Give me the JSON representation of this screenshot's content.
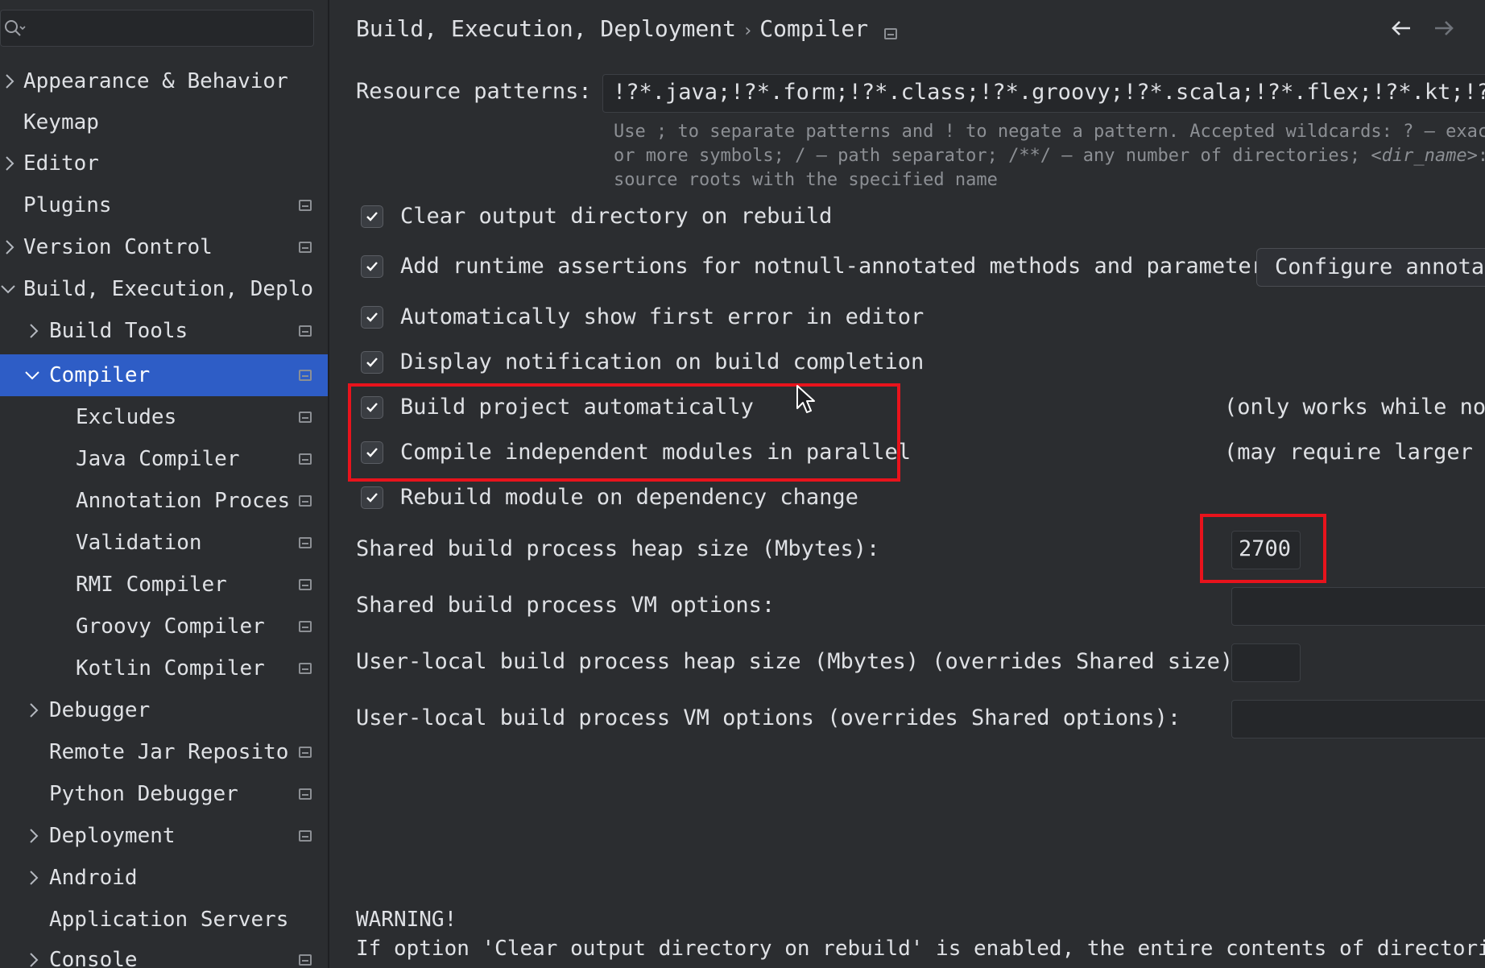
{
  "search": {
    "value": ""
  },
  "sidebar": {
    "items": [
      {
        "label": "Appearance & Behavior"
      },
      {
        "label": "Keymap"
      },
      {
        "label": "Editor"
      },
      {
        "label": "Plugins"
      },
      {
        "label": "Version Control"
      },
      {
        "label": "Build, Execution, Deplo"
      },
      {
        "label": "Build Tools"
      },
      {
        "label": "Compiler"
      },
      {
        "label": "Excludes"
      },
      {
        "label": "Java Compiler"
      },
      {
        "label": "Annotation Proces"
      },
      {
        "label": "Validation"
      },
      {
        "label": "RMI Compiler"
      },
      {
        "label": "Groovy Compiler"
      },
      {
        "label": "Kotlin Compiler"
      },
      {
        "label": "Debugger"
      },
      {
        "label": "Remote Jar Reposito"
      },
      {
        "label": "Python Debugger"
      },
      {
        "label": "Deployment"
      },
      {
        "label": "Android"
      },
      {
        "label": "Application Servers"
      },
      {
        "label": "Console"
      }
    ]
  },
  "breadcrumb": {
    "parent": "Build, Execution, Deployment",
    "separator": "›",
    "current": "Compiler"
  },
  "resource": {
    "label": "Resource patterns:",
    "value": "!?*.java;!?*.form;!?*.class;!?*.groovy;!?*.scala;!?*.flex;!?*.kt;!?*.c",
    "hint1": "Use ; to separate patterns and ! to negate a pattern. Accepted wildcards: ? — exac",
    "hint2a": "or more symbols; / — path separator; /**/ — any number of directories; ",
    "hint2b": "<dir_name>",
    "hint2c": ":",
    "hint3": "source roots with the specified name"
  },
  "options": {
    "clear_output": "Clear output directory on rebuild",
    "runtime_assertions": "Add runtime assertions for notnull-annotated methods and parameters",
    "configure_button": "Configure annotat",
    "show_first_error": "Automatically show first error in editor",
    "display_notification": "Display notification on build completion",
    "build_auto": "Build project automatically",
    "build_auto_note": "(only works while not",
    "compile_parallel": "Compile independent modules in parallel",
    "compile_parallel_note": "(may require larger h",
    "rebuild_module": "Rebuild module on dependency change"
  },
  "heap": {
    "shared_label": "Shared build process heap size (Mbytes):",
    "shared_value": "2700",
    "vm_label": "Shared build process VM options:",
    "vm_value": "",
    "user_heap_label": "User-local build process heap size (Mbytes) (overrides Shared size):",
    "user_heap_value": "",
    "user_vm_label": "User-local build process VM options (overrides Shared options):",
    "user_vm_value": ""
  },
  "warning": {
    "title": "WARNING!",
    "text": "If option 'Clear output directory on rebuild' is enabled, the entire contents of directori"
  },
  "colors": {
    "selection": "#2e5dc6",
    "highlight": "#e8131c",
    "background": "#2b2d30"
  }
}
